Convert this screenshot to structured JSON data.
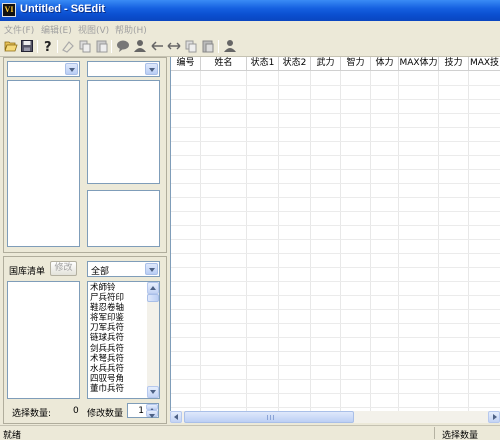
{
  "window": {
    "title": "Untitled - S6Edit",
    "icon_text": "VI"
  },
  "menu": [
    "文件(F)",
    "编辑(E)",
    "视图(V)",
    "帮助(H)"
  ],
  "toolbar": {
    "icons": [
      "open-icon",
      "save-icon",
      "help-icon",
      "eye-icon",
      "copy-icon",
      "paste-icon",
      "comment-icon",
      "person-icon",
      "arrow-left-icon",
      "arrow-both-icon",
      "copy2-icon",
      "paste2-icon",
      "person2-icon"
    ]
  },
  "left_panel": {
    "combo1": {
      "value": ""
    },
    "combo2": {
      "value": ""
    },
    "warehouse_label": "国库清单",
    "edit_button": "修改",
    "filter_combo": {
      "value": "全部"
    },
    "items": [
      "术師铃",
      "尸兵符印",
      "鞋忍卷轴",
      "将军印鉴",
      "刀军兵符",
      "链球兵符",
      "剑兵兵符",
      "术弩兵符",
      "水兵兵符",
      "四驭号角",
      "董巾兵符"
    ],
    "selected_count_label": "选择数量:",
    "selected_count_value": "0",
    "modify_count_label": "修改数量",
    "modify_count_value": "1"
  },
  "grid": {
    "columns": [
      "编号",
      "姓名",
      "状态1",
      "状态2",
      "武力",
      "智力",
      "体力",
      "MAX体力",
      "技力",
      "MAX技"
    ]
  },
  "status": {
    "left": "就绪",
    "right": "选择数量"
  }
}
